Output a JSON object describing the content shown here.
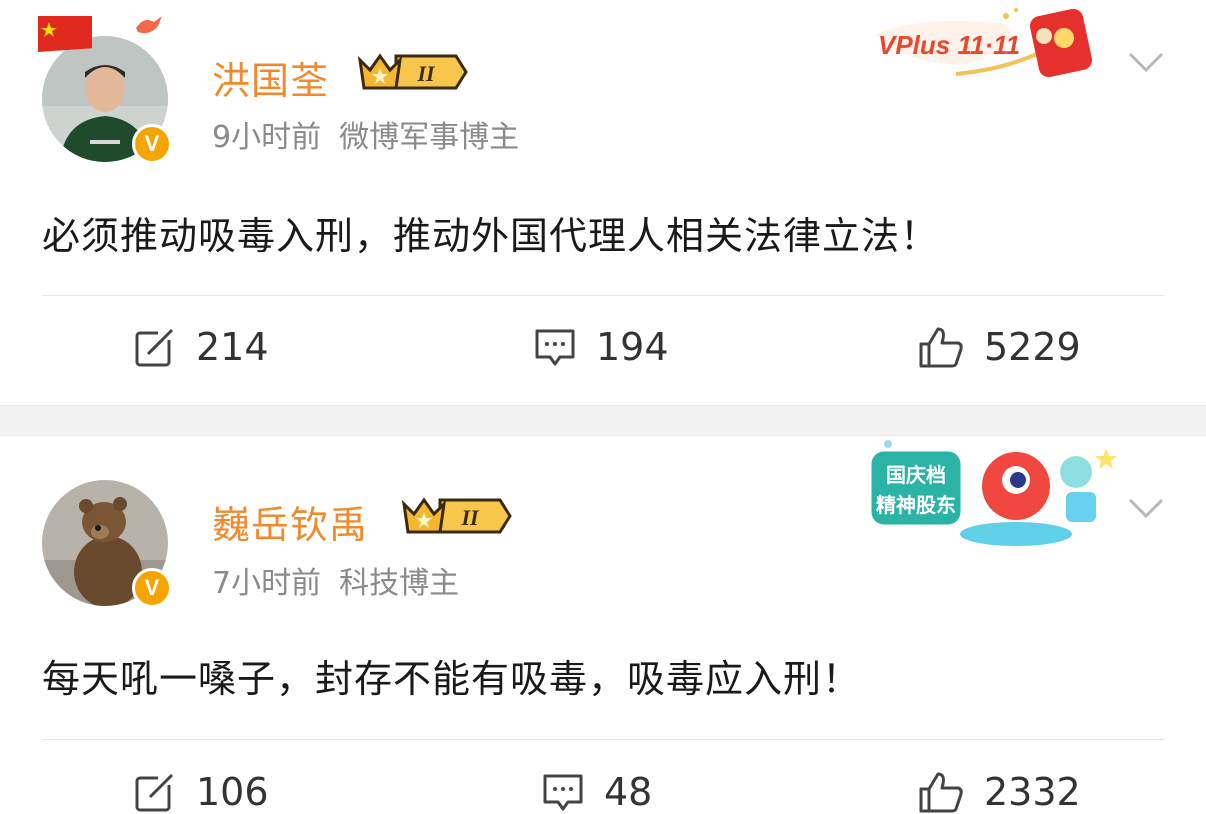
{
  "posts": [
    {
      "author": "洪国荃",
      "level": "II",
      "time": "9小时前",
      "source": "微博军事博主",
      "text": "必须推动吸毒入刑，推动外国代理人相关法律立法！",
      "reposts": "214",
      "comments": "194",
      "likes": "5229",
      "banner_text": "VPlus 11·11",
      "verified": "V"
    },
    {
      "author": "巍岳钦禹",
      "level": "II",
      "time": "7小时前",
      "source": "科技博主",
      "text": "每天吼一嗓子，封存不能有吸毒，吸毒应入刑！",
      "reposts": "106",
      "comments": "48",
      "likes": "2332",
      "banner_text_1": "国庆档",
      "banner_text_2": "精神股东",
      "verified": "V"
    }
  ],
  "colors": {
    "name": "#f08a2c",
    "badge_gold": "#f6a400",
    "meta": "#8a8a8a",
    "text": "#1a1a1a"
  },
  "icons": [
    "repost-icon",
    "comment-icon",
    "like-icon",
    "chevron-down-icon",
    "crown-icon",
    "verified-icon"
  ]
}
